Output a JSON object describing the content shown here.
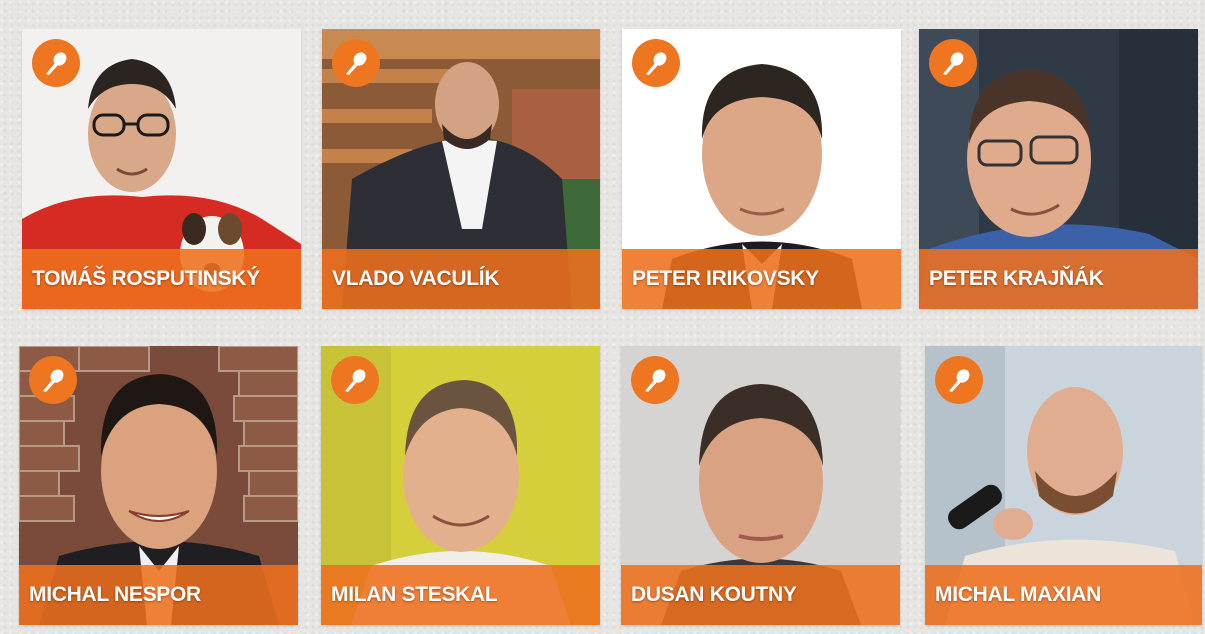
{
  "speakers": [
    {
      "name": "TOMÁŠ ROSPUTINSKÝ"
    },
    {
      "name": "VLADO VACULÍK"
    },
    {
      "name": "PETER IRIKOVSKY"
    },
    {
      "name": "PETER KRAJŇÁK"
    },
    {
      "name": "MICHAL NESPOR"
    },
    {
      "name": "MILAN STESKAL"
    },
    {
      "name": "DUSAN KOUTNY"
    },
    {
      "name": "MICHAL MAXIAN"
    }
  ],
  "colors": {
    "accent": "#ee7621",
    "name_bar": "#ee701e",
    "background": "#e7e5e2"
  },
  "icons": {
    "badge": "microphone-icon"
  }
}
